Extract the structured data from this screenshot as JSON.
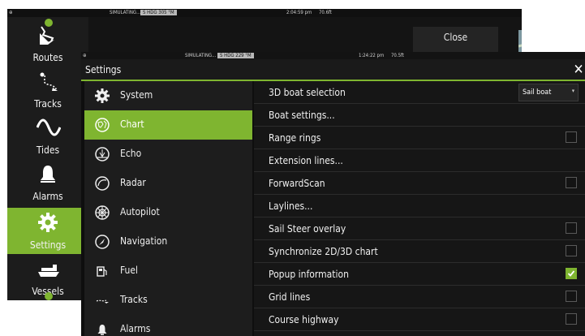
{
  "background_window": {
    "statusbar": {
      "mode": "SIMULATING...",
      "heading": "S HDG 305 °M",
      "time": "2:04:59 pm",
      "depth": "70.6ft"
    },
    "close_label": "Close",
    "sidebar": [
      {
        "label": "Routes",
        "icon": "routes-icon"
      },
      {
        "label": "Tracks",
        "icon": "tracks-icon"
      },
      {
        "label": "Tides",
        "icon": "tides-icon"
      },
      {
        "label": "Alarms",
        "icon": "bell-icon"
      },
      {
        "label": "Settings",
        "icon": "gear-icon",
        "selected": true
      },
      {
        "label": "Vessels",
        "icon": "vessels-icon"
      }
    ]
  },
  "settings": {
    "statusbar": {
      "mode": "SIMULATING...",
      "heading": "S HDG 229 °M",
      "time": "1:24:22 pm",
      "depth": "70.5ft"
    },
    "title": "Settings",
    "categories": [
      {
        "label": "System",
        "icon": "gear-icon"
      },
      {
        "label": "Chart",
        "icon": "chart-icon",
        "selected": true
      },
      {
        "label": "Echo",
        "icon": "echo-icon"
      },
      {
        "label": "Radar",
        "icon": "radar-icon"
      },
      {
        "label": "Autopilot",
        "icon": "autopilot-icon"
      },
      {
        "label": "Navigation",
        "icon": "navigation-icon"
      },
      {
        "label": "Fuel",
        "icon": "fuel-icon"
      },
      {
        "label": "Tracks",
        "icon": "tracks-icon"
      },
      {
        "label": "Alarms",
        "icon": "bell-icon"
      }
    ],
    "options": [
      {
        "label": "3D boat selection",
        "control": "select",
        "value": "Sail boat"
      },
      {
        "label": "Boat settings...",
        "control": "none"
      },
      {
        "label": "Range rings",
        "control": "checkbox",
        "checked": false
      },
      {
        "label": "Extension lines...",
        "control": "none"
      },
      {
        "label": "ForwardScan",
        "control": "checkbox",
        "checked": false
      },
      {
        "label": "Laylines...",
        "control": "none"
      },
      {
        "label": "Sail Steer overlay",
        "control": "checkbox",
        "checked": false
      },
      {
        "label": "Synchronize 2D/3D chart",
        "control": "checkbox",
        "checked": false
      },
      {
        "label": "Popup information",
        "control": "checkbox",
        "checked": true
      },
      {
        "label": "Grid lines",
        "control": "checkbox",
        "checked": false
      },
      {
        "label": "Course highway",
        "control": "checkbox",
        "checked": false
      }
    ]
  },
  "colors": {
    "accent": "#7fb530",
    "panel": "#1d1d1d",
    "background": "#0e0e0e"
  }
}
